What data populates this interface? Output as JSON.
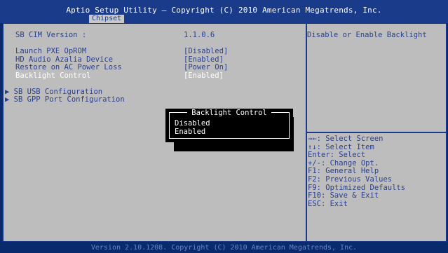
{
  "header": {
    "title": "Aptio Setup Utility – Copyright (C) 2010 American Megatrends, Inc.",
    "active_tab": "Chipset"
  },
  "settings": {
    "sb_cim_label": "SB CIM Version :",
    "sb_cim_value": "1.1.0.6",
    "items": [
      {
        "label": "Launch PXE OpROM",
        "value": "[Disabled]"
      },
      {
        "label": "HD Audio Azalia Device",
        "value": "[Enabled]"
      },
      {
        "label": "Restore on AC Power Loss",
        "value": "[Power On]"
      },
      {
        "label": "Backlight Control",
        "value": "[Enabled]"
      }
    ],
    "submenus": [
      {
        "marker": "▶",
        "label": "SB USB Configuration"
      },
      {
        "marker": "▶",
        "label": "SB GPP Port Configuration"
      }
    ]
  },
  "help": {
    "description": "Disable or Enable Backlight",
    "keys": [
      "→←: Select Screen",
      "↑↓: Select Item",
      "Enter: Select",
      "+/-: Change Opt.",
      "F1: General Help",
      "F2: Previous Values",
      "F9: Optimized Defaults",
      "F10: Save & Exit",
      "ESC: Exit"
    ]
  },
  "popup": {
    "title": "Backlight Control",
    "options": [
      "Disabled",
      "Enabled"
    ]
  },
  "footer": {
    "text": "Version 2.10.1208. Copyright (C) 2010 American Megatrends, Inc."
  },
  "colors": {
    "background": "#0d2a6e",
    "panel": "#bdbdbd",
    "text": "#2a3f8f",
    "highlight": "#ffffff",
    "popup": "#000000"
  }
}
